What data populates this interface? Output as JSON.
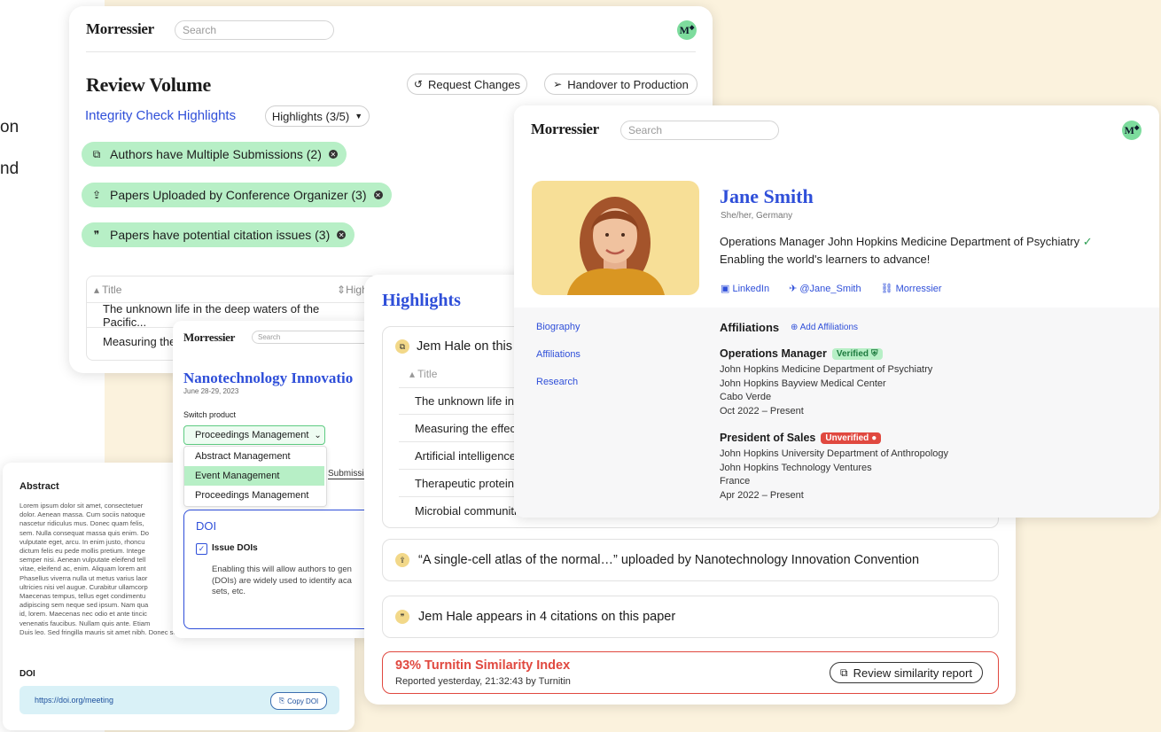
{
  "edge_text": [
    "on",
    "nd"
  ],
  "brand": "Morressier",
  "search_placeholder": "Search",
  "avatar_initial": "M",
  "review": {
    "title": "Review Volume",
    "request_changes": "Request Changes",
    "handover": "Handover to Production",
    "integrity_label": "Integrity Check Highlights",
    "highlights_dropdown": "Highlights (3/5)",
    "chips": [
      "Authors have Multiple Submissions (2)",
      "Papers Uploaded by Conference Organizer (3)",
      "Papers have potential citation issues (3)"
    ],
    "table_col_title": "Title",
    "table_col_high": "High",
    "rows": [
      "The unknown life in the deep waters of the Pacific...",
      "Measuring the"
    ]
  },
  "nano": {
    "title": "Nanotechnology Innovatio",
    "date": "June 28-29, 2023",
    "switch_label": "Switch product",
    "selected": "Proceedings Management",
    "options": [
      "Abstract Management",
      "Event Management",
      "Proceedings Management"
    ],
    "tab_fragment": "Submissi",
    "doi_heading": "DOI",
    "issue_dois": "Issue DOIs",
    "doi_desc": [
      "Enabling this will allow authors to gen",
      "(DOIs) are widely used to identify aca",
      "sets, etc."
    ]
  },
  "abstract": {
    "heading": "Abstract",
    "lines": [
      "Lorem ipsum dolor sit amet, consectetuer",
      "dolor. Aenean massa. Cum sociis natoque",
      "nascetur ridiculus mus. Donec quam felis,",
      "sem. Nulla consequat massa quis enim. Do",
      "vulputate eget, arcu. In enim justo, rhoncu",
      "dictum felis eu pede mollis pretium. Intege",
      "semper nisi. Aenean vulputate eleifend tell",
      "vitae, eleifend ac, enim. Aliquam lorem ant",
      "Phasellus viverra nulla ut metus varius laor",
      "ultricies nisi vel augue. Curabitur ullamcorp",
      "Maecenas tempus, tellus eget condimentu",
      "adipiscing sem neque sed ipsum. Nam qua",
      "id, lorem. Maecenas nec odio et ante tincic",
      "venenatis faucibus. Nullam quis ante. Etiam",
      "Duis leo. Sed fringilla mauris sit amet nibh. Donec sodales sagittis magna."
    ],
    "doi_heading": "DOI",
    "doi_url": "https://doi.org/meeting",
    "copy_doi": "Copy DOI"
  },
  "highlights": {
    "title": "Highlights",
    "jem_fragment": "Jem Hale on this",
    "col_title": "Title",
    "rows": [
      "The unknown life in th",
      "Measuring the effect",
      "Artificial intelligence a",
      "Therapeutic proteins",
      "Microbial communitie"
    ],
    "uploaded": "“A single-cell atlas of the normal…” uploaded by Nanotechnology Innovation Convention",
    "citations": "Jem Hale appears in 4 citations on this paper",
    "turnitin_title": "93% Turnitin Similarity Index",
    "turnitin_sub": "Reported yesterday, 21:32:43 by Turnitin",
    "review_report": "Review similarity report"
  },
  "profile": {
    "name": "Jane Smith",
    "pronouns": "She/her, Germany",
    "role": "Operations Manager John Hopkins Medicine Department of Psychiatry",
    "tagline": "Enabling the world's learners to advance!",
    "links": [
      "LinkedIn",
      "@Jane_Smith",
      "Morressier"
    ],
    "nav": [
      "Biography",
      "Affiliations",
      "Research"
    ],
    "affiliations_heading": "Affiliations",
    "add_affiliations": "Add Affiliations",
    "verified": "Verified",
    "unverified": "Unverified",
    "aff1": {
      "title": "Operations Manager",
      "lines": [
        "John Hopkins Medicine Department of Psychiatry",
        "John Hopkins  Bayview Medical Center",
        "Cabo Verde",
        "Oct 2022 – Present"
      ]
    },
    "aff2": {
      "title": "President of Sales",
      "lines": [
        "John Hopkins University Department of Anthropology",
        "John Hopkins Technology Ventures",
        "France",
        "Apr 2022 – Present"
      ]
    }
  },
  "colors": {
    "accent_blue": "#2f4fd9",
    "chip_green": "#b7efc6",
    "cream": "#fbf2dd",
    "alert_red": "#e0483f"
  }
}
